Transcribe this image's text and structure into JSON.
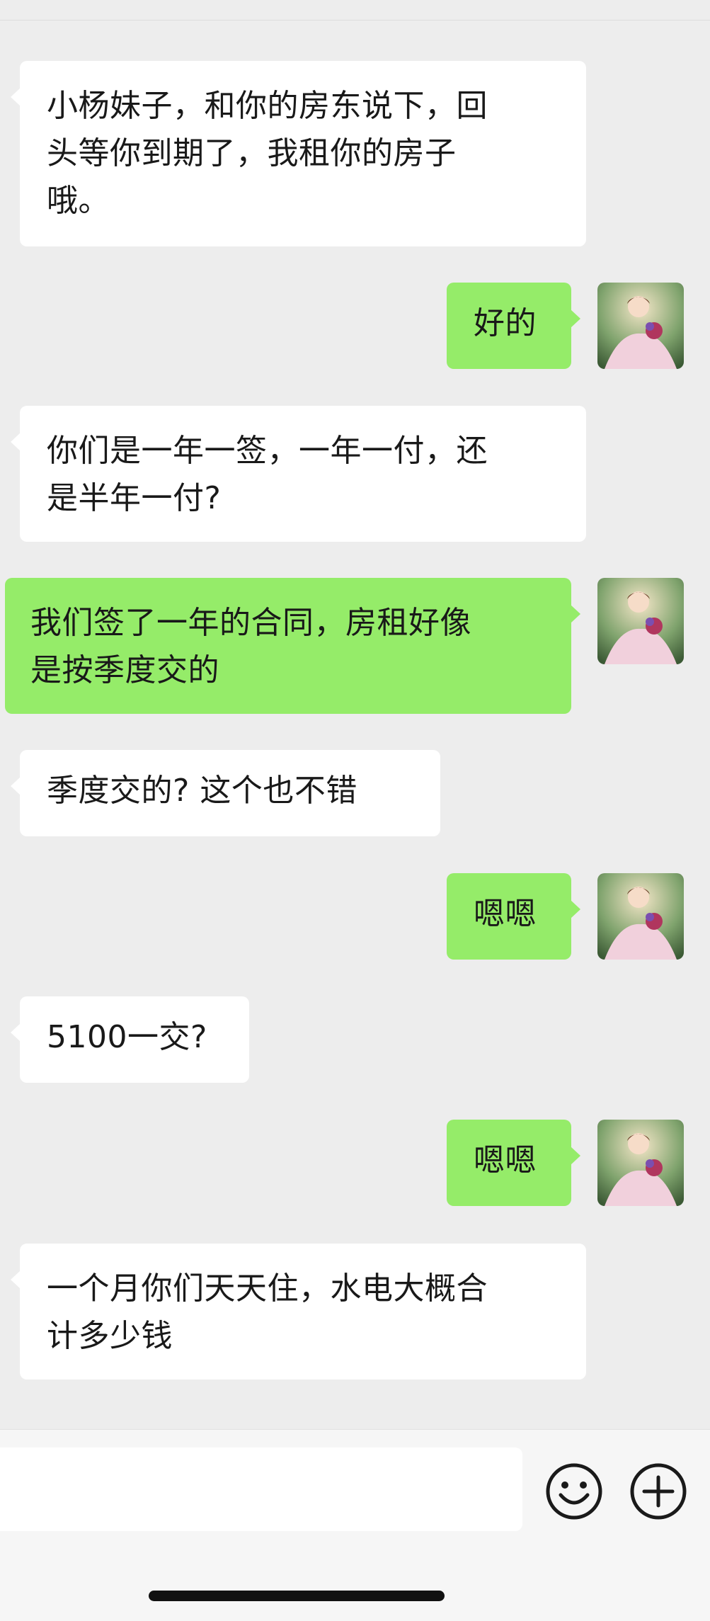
{
  "messages": [
    {
      "side": "in",
      "text": "小杨妹子，和你的房东说下，回\n头等你到期了，我租你的房子\n哦。"
    },
    {
      "side": "out",
      "text": "好的"
    },
    {
      "side": "in",
      "text": "你们是一年一签，一年一付，还\n是半年一付?"
    },
    {
      "side": "out",
      "text": "我们签了一年的合同，房租好像\n是按季度交的"
    },
    {
      "side": "in",
      "text": "季度交的? 这个也不错"
    },
    {
      "side": "out",
      "text": "嗯嗯"
    },
    {
      "side": "in",
      "text": "5100一交?"
    },
    {
      "side": "out",
      "text": "嗯嗯"
    },
    {
      "side": "in",
      "text": "一个月你们天天住，水电大概合\n计多少钱"
    }
  ],
  "input_bar": {
    "text_value": "",
    "icons": [
      "emoji-icon",
      "plus-icon"
    ]
  },
  "colors": {
    "background": "#ededed",
    "incoming_bubble": "#ffffff",
    "outgoing_bubble": "#95ec69",
    "text": "#191919"
  }
}
